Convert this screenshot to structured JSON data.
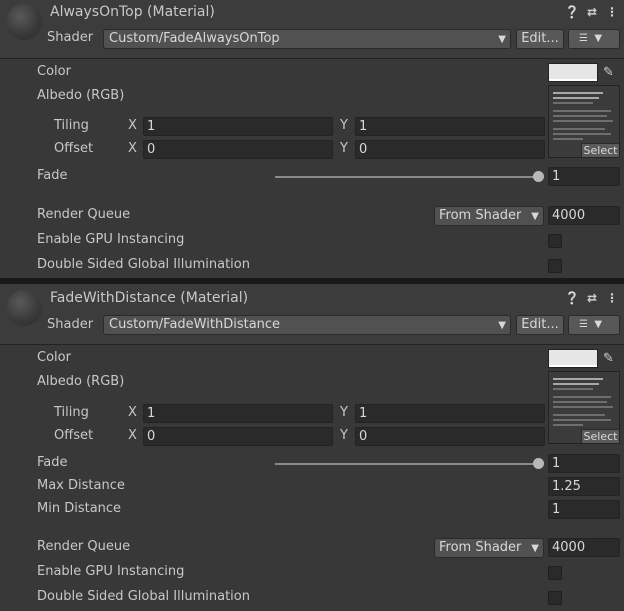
{
  "materials": [
    {
      "title": "AlwaysOnTop (Material)",
      "shader_label": "Shader",
      "shader_value": "Custom/FadeAlwaysOnTop",
      "edit_label": "Edit...",
      "color_label": "Color",
      "color_value": "#e6e6e6",
      "albedo_label": "Albedo (RGB)",
      "tiling_label": "Tiling",
      "offset_label": "Offset",
      "x_label": "X",
      "y_label": "Y",
      "tiling_x": "1",
      "tiling_y": "1",
      "offset_x": "0",
      "offset_y": "0",
      "select_label": "Select",
      "fade_label": "Fade",
      "fade_value": "1",
      "fade_level": 1.0,
      "render_queue_label": "Render Queue",
      "render_queue_option": "From Shader",
      "render_queue_value": "4000",
      "gpu_instancing_label": "Enable GPU Instancing",
      "gpu_instancing_checked": false,
      "double_sided_gi_label": "Double Sided Global Illumination",
      "double_sided_gi_checked": false
    },
    {
      "title": "FadeWithDistance (Material)",
      "shader_label": "Shader",
      "shader_value": "Custom/FadeWithDistance",
      "edit_label": "Edit...",
      "color_label": "Color",
      "color_value": "#e6e6e6",
      "albedo_label": "Albedo (RGB)",
      "tiling_label": "Tiling",
      "offset_label": "Offset",
      "x_label": "X",
      "y_label": "Y",
      "tiling_x": "1",
      "tiling_y": "1",
      "offset_x": "0",
      "offset_y": "0",
      "select_label": "Select",
      "fade_label": "Fade",
      "fade_value": "1",
      "fade_level": 1.0,
      "max_distance_label": "Max Distance",
      "max_distance_value": "1.25",
      "min_distance_label": "Min Distance",
      "min_distance_value": "1",
      "render_queue_label": "Render Queue",
      "render_queue_option": "From Shader",
      "render_queue_value": "4000",
      "gpu_instancing_label": "Enable GPU Instancing",
      "gpu_instancing_checked": false,
      "double_sided_gi_label": "Double Sided Global Illumination",
      "double_sided_gi_checked": false
    }
  ],
  "icons": {
    "help": "help-icon",
    "presets": "presets-icon",
    "more": "more-options-icon",
    "dropdown": "chevron-down-icon",
    "eyedropper": "eyedropper-icon",
    "list": "list-icon"
  }
}
